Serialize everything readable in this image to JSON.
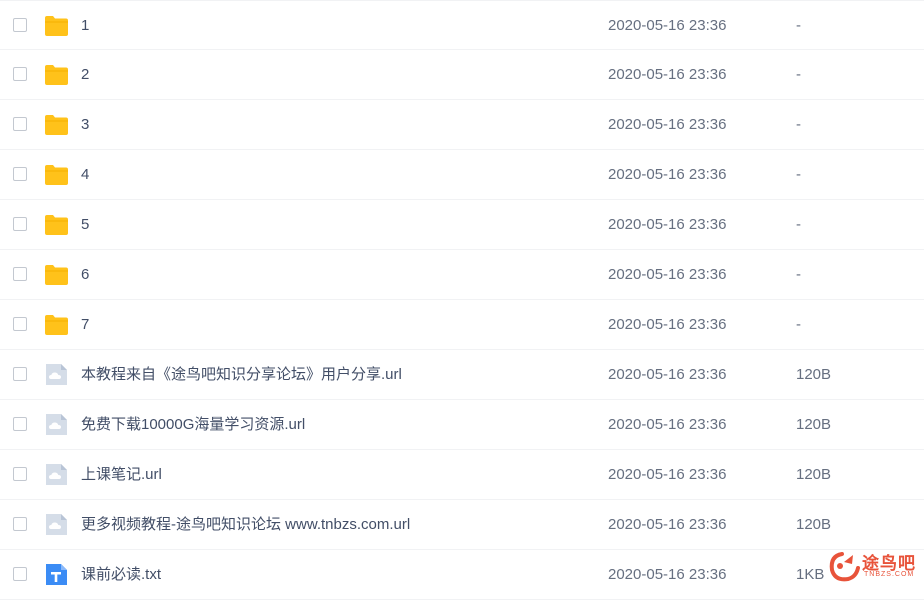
{
  "files": [
    {
      "name": "1",
      "type": "folder",
      "date": "2020-05-16 23:36",
      "size": "-"
    },
    {
      "name": "2",
      "type": "folder",
      "date": "2020-05-16 23:36",
      "size": "-"
    },
    {
      "name": "3",
      "type": "folder",
      "date": "2020-05-16 23:36",
      "size": "-"
    },
    {
      "name": "4",
      "type": "folder",
      "date": "2020-05-16 23:36",
      "size": "-"
    },
    {
      "name": "5",
      "type": "folder",
      "date": "2020-05-16 23:36",
      "size": "-"
    },
    {
      "name": "6",
      "type": "folder",
      "date": "2020-05-16 23:36",
      "size": "-"
    },
    {
      "name": "7",
      "type": "folder",
      "date": "2020-05-16 23:36",
      "size": "-"
    },
    {
      "name": "本教程来自《途鸟吧知识分享论坛》用户分享.url",
      "type": "link",
      "date": "2020-05-16 23:36",
      "size": "120B"
    },
    {
      "name": "免费下载10000G海量学习资源.url",
      "type": "link",
      "date": "2020-05-16 23:36",
      "size": "120B"
    },
    {
      "name": "上课笔记.url",
      "type": "link",
      "date": "2020-05-16 23:36",
      "size": "120B"
    },
    {
      "name": "更多视频教程-途鸟吧知识论坛 www.tnbzs.com.url",
      "type": "link",
      "date": "2020-05-16 23:36",
      "size": "120B"
    },
    {
      "name": "课前必读.txt",
      "type": "text",
      "date": "2020-05-16 23:36",
      "size": "1KB"
    }
  ],
  "watermark": {
    "title": "途鸟吧",
    "subtitle": "TNBZS.COM"
  },
  "colors": {
    "folder": "#ffc21a",
    "link_icon": "#b8c4d6",
    "text_icon": "#3b8cf5"
  }
}
